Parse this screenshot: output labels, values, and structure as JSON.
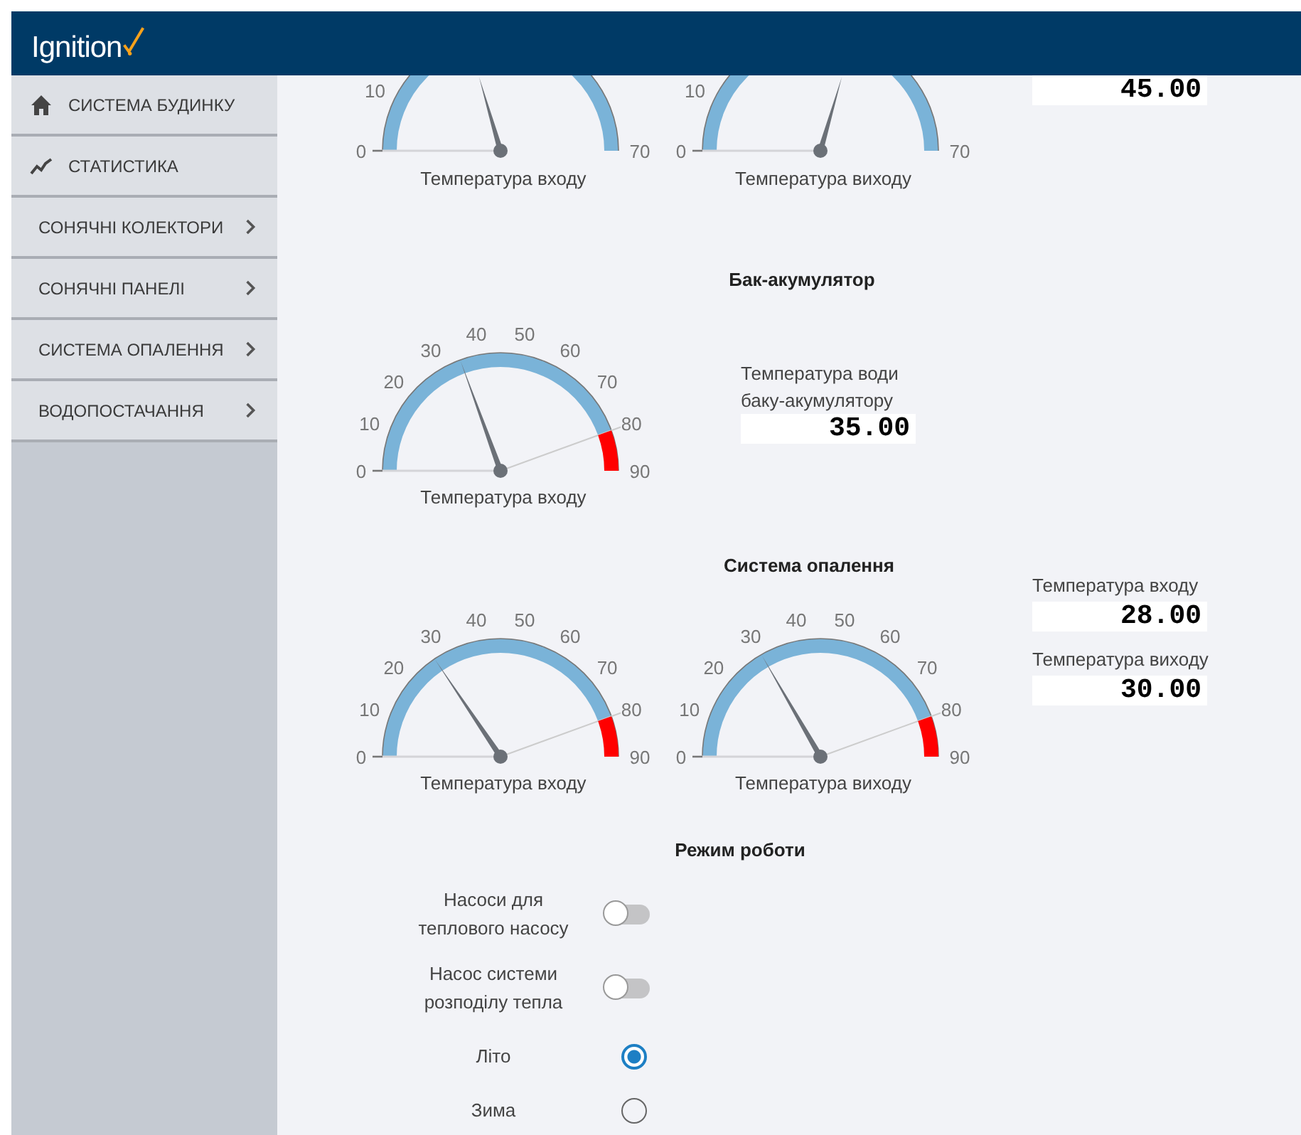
{
  "header": {
    "logo": "Ignition"
  },
  "sidebar": {
    "items": [
      {
        "label": "СИСТЕМА БУДИНКУ",
        "kind": "page"
      },
      {
        "label": "СТАТИСТИКА",
        "kind": "page"
      },
      {
        "label": "СОНЯЧНІ КОЛЕКТОРИ",
        "kind": "submenu"
      },
      {
        "label": "СОНЯЧНІ ПАНЕЛІ",
        "kind": "submenu"
      },
      {
        "label": "СИСТЕМА ОПАЛЕННЯ",
        "kind": "submenu"
      },
      {
        "label": "ВОДОПОСТАЧАННЯ",
        "kind": "submenu"
      }
    ]
  },
  "top_row": {
    "gauges": [
      {
        "caption": "Температура входу",
        "ticks": [
          "0",
          "10",
          "70"
        ]
      },
      {
        "caption": "Температура виходу",
        "ticks": [
          "0",
          "10",
          "70"
        ]
      }
    ],
    "readout": {
      "value": "45.00"
    }
  },
  "tank": {
    "title": "Бак-акумулятор",
    "gauge": {
      "caption": "Температура входу",
      "alarm_zone": true,
      "ticks": [
        "0",
        "10",
        "20",
        "30",
        "40",
        "50",
        "60",
        "70",
        "80",
        "90"
      ]
    },
    "readout": {
      "label": "Температура води баку-акумулятору",
      "value": "35.00"
    }
  },
  "heating": {
    "title": "Система опалення",
    "gauges": [
      {
        "caption": "Температура входу",
        "alarm_zone": true,
        "ticks": [
          "0",
          "10",
          "20",
          "30",
          "40",
          "50",
          "60",
          "70",
          "80",
          "90"
        ]
      },
      {
        "caption": "Температура виходу",
        "alarm_zone": true,
        "ticks": [
          "0",
          "10",
          "20",
          "30",
          "40",
          "50",
          "60",
          "70",
          "80",
          "90"
        ]
      }
    ],
    "readouts": [
      {
        "label": "Температура входу",
        "value": "28.00"
      },
      {
        "label": "Температура виходу",
        "value": "30.00"
      }
    ]
  },
  "mode": {
    "title": "Режим роботи",
    "switches": [
      {
        "label": "Насоси для теплового насосу",
        "on": false
      },
      {
        "label": "Насос системи розподілу тепла",
        "on": false
      }
    ],
    "options": [
      {
        "label": "Літо",
        "selected": true
      },
      {
        "label": "Зима",
        "selected": false
      }
    ]
  }
}
